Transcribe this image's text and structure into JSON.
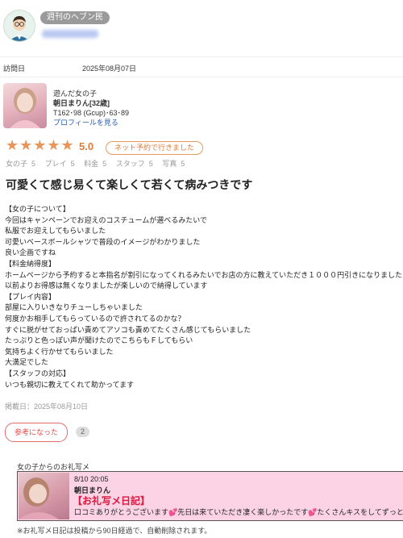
{
  "user": {
    "badge": "週刊のヘブン民"
  },
  "visit": {
    "label": "訪問日",
    "date": "2025年08月07日"
  },
  "girl": {
    "subtitle": "遊んだ女の子",
    "name": "朝日まりん[32歳]",
    "specs": "T162･98 (Gcup)･63･89",
    "profile_link": "プロフィールを見る"
  },
  "rating": {
    "stars": "★★★★★",
    "score": "5.0",
    "badge": "ネット予約で行きました"
  },
  "sub_ratings": [
    {
      "label": "女の子",
      "value": "5"
    },
    {
      "label": "プレイ",
      "value": "5"
    },
    {
      "label": "料金",
      "value": "5"
    },
    {
      "label": "スタッフ",
      "value": "5"
    },
    {
      "label": "写真",
      "value": "5"
    }
  ],
  "review": {
    "title": "可愛くて感じ易くて楽しくて若くて病みつきです",
    "lines": [
      "【女の子について】",
      "今回はキャンペーンでお迎えのコスチュームが選べるみたいで",
      "私服でお迎えしてもらいました",
      "可愛いベースボールシャツで普段のイメージがわかりました",
      "良い企画ですね",
      "【料金納得度】",
      "ホームページから予約すると本指名が割引になってくれるみたいでお店の方に教えていただき１０００円引きになりました",
      "以前よりお得感は無くなりましたが楽しいので納得しています",
      "【プレイ内容】",
      "部屋に入りいきなりチューしちゃいました",
      "何度かお相手してもらっているので許されてるのかな？",
      "すぐに脱がせておっぱい責めてアソコも責めてたくさん感じてもらいました",
      "たっぷりと色っぽい声が聞けたのでこちらもＦしてもらい",
      "気持ちよく行かせてもらいました",
      "大満足でした",
      "【スタッフの対応】",
      "いつも親切に教えてくれて助かってます"
    ],
    "posted": "掲載日：2025年08月10日"
  },
  "helpful": {
    "label": "参考になった",
    "count": "2"
  },
  "message": {
    "heading": "女の子からのお礼写メ",
    "time": "8/10 20:05",
    "girl_name": "朝日まりん",
    "title": "【お礼写メ日記】",
    "body": "口コミありがとうございます💕先日は来ていただき凄く楽しかったです💕たくさんキスをしてずっと入って"
  },
  "note": "※お礼写メ日記は投稿から90日経過で、自動削除されます。"
}
